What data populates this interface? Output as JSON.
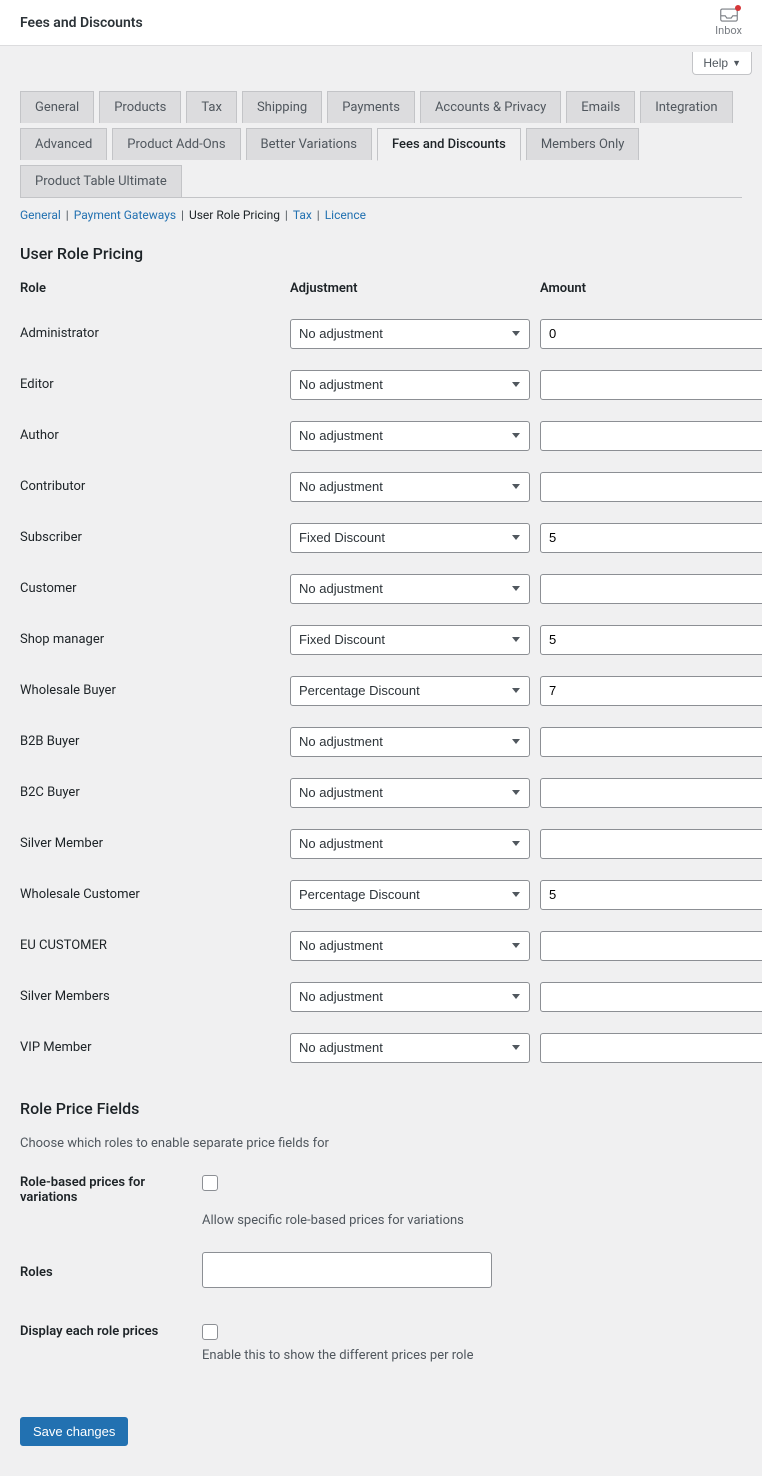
{
  "topbar": {
    "title": "Fees and Discounts",
    "inbox_label": "Inbox"
  },
  "help_label": "Help",
  "tabs_row1": [
    "General",
    "Products",
    "Tax",
    "Shipping",
    "Payments",
    "Accounts & Privacy",
    "Emails",
    "Integration",
    "Advanced",
    "Product Add-Ons"
  ],
  "tabs_row2": [
    "Better Variations",
    "Fees and Discounts",
    "Members Only",
    "Product Table Ultimate"
  ],
  "active_tab": "Fees and Discounts",
  "subnav": {
    "links": [
      "General",
      "Payment Gateways",
      "User Role Pricing",
      "Tax",
      "Licence"
    ],
    "current": "User Role Pricing"
  },
  "section1_title": "User Role Pricing",
  "headers": {
    "role": "Role",
    "adjustment": "Adjustment",
    "amount": "Amount"
  },
  "adjust_options": [
    "No adjustment",
    "Fixed Discount",
    "Percentage Discount"
  ],
  "roles": [
    {
      "label": "Administrator",
      "adjustment": "No adjustment",
      "amount": "0"
    },
    {
      "label": "Editor",
      "adjustment": "No adjustment",
      "amount": ""
    },
    {
      "label": "Author",
      "adjustment": "No adjustment",
      "amount": ""
    },
    {
      "label": "Contributor",
      "adjustment": "No adjustment",
      "amount": ""
    },
    {
      "label": "Subscriber",
      "adjustment": "Fixed Discount",
      "amount": "5"
    },
    {
      "label": "Customer",
      "adjustment": "No adjustment",
      "amount": ""
    },
    {
      "label": "Shop manager",
      "adjustment": "Fixed Discount",
      "amount": "5"
    },
    {
      "label": "Wholesale Buyer",
      "adjustment": "Percentage Discount",
      "amount": "7"
    },
    {
      "label": "B2B Buyer",
      "adjustment": "No adjustment",
      "amount": ""
    },
    {
      "label": "B2C Buyer",
      "adjustment": "No adjustment",
      "amount": ""
    },
    {
      "label": "Silver Member",
      "adjustment": "No adjustment",
      "amount": ""
    },
    {
      "label": "Wholesale Customer",
      "adjustment": "Percentage Discount",
      "amount": "5"
    },
    {
      "label": "EU CUSTOMER",
      "adjustment": "No adjustment",
      "amount": ""
    },
    {
      "label": "Silver Members",
      "adjustment": "No adjustment",
      "amount": ""
    },
    {
      "label": "VIP Member",
      "adjustment": "No adjustment",
      "amount": ""
    }
  ],
  "section2_title": "Role Price Fields",
  "section2_desc": "Choose which roles to enable separate price fields for",
  "field_variations": {
    "label": "Role-based prices for variations",
    "help": "Allow specific role-based prices for variations"
  },
  "field_roles": {
    "label": "Roles"
  },
  "field_display": {
    "label": "Display each role prices",
    "help": "Enable this to show the different prices per role"
  },
  "save_label": "Save changes"
}
